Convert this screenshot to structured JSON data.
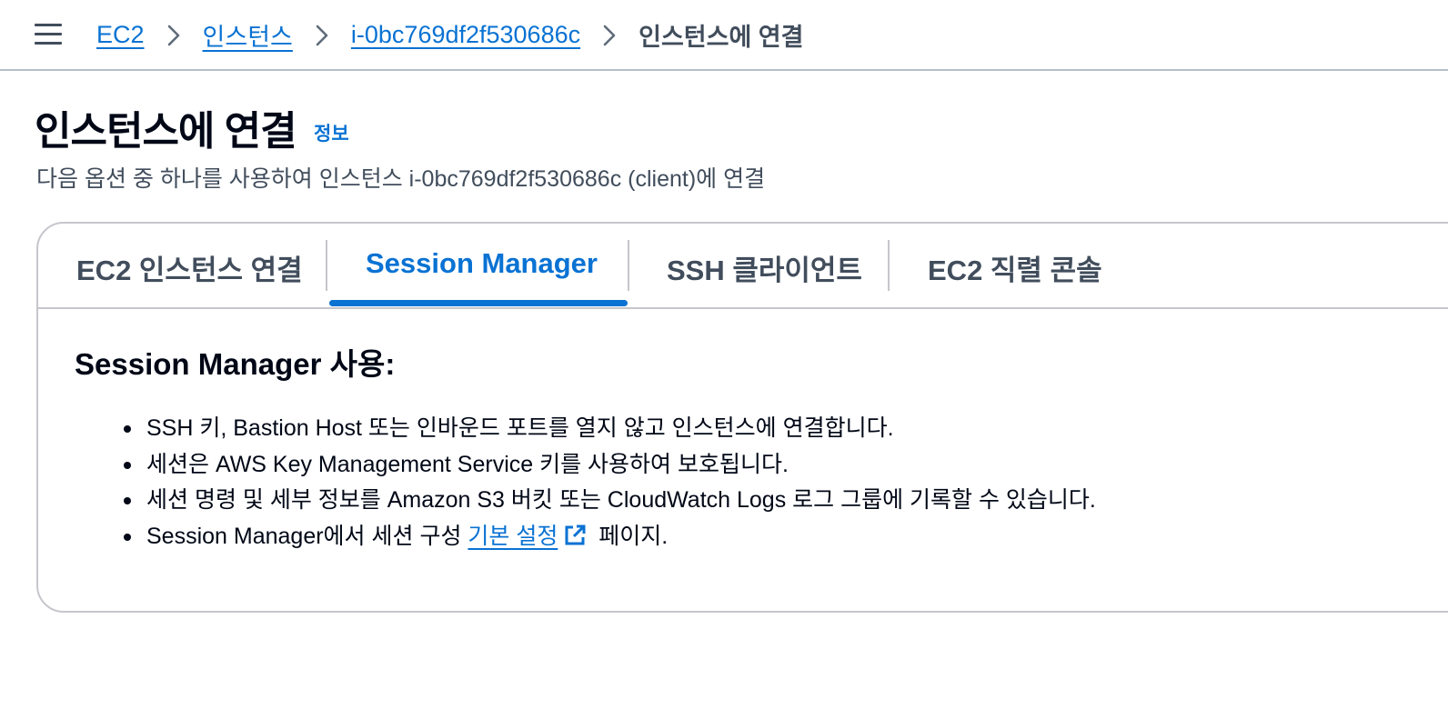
{
  "breadcrumb": {
    "items": [
      {
        "label": "EC2"
      },
      {
        "label": "인스턴스"
      },
      {
        "label": "i-0bc769df2f530686c"
      }
    ],
    "current": "인스턴스에 연결"
  },
  "header": {
    "title": "인스턴스에 연결",
    "info_link": "정보",
    "subtitle": "다음 옵션 중 하나를 사용하여 인스턴스 i-0bc769df2f530686c (client)에 연결"
  },
  "tabs": [
    {
      "label": "EC2 인스턴스 연결",
      "active": false
    },
    {
      "label": "Session Manager",
      "active": true
    },
    {
      "label": "SSH 클라이언트",
      "active": false
    },
    {
      "label": "EC2 직렬 콘솔",
      "active": false
    }
  ],
  "content": {
    "heading": "Session Manager 사용:",
    "bullets": [
      "SSH 키, Bastion Host 또는 인바운드 포트를 열지 않고 인스턴스에 연결합니다.",
      "세션은 AWS Key Management Service 키를 사용하여 보호됩니다.",
      "세션 명령 및 세부 정보를 Amazon S3 버킷 또는 CloudWatch Logs 로그 그룹에 기록할 수 있습니다."
    ],
    "last_bullet": {
      "prefix": "Session Manager에서 세션 구성 ",
      "link": "기본 설정",
      "suffix": " 페이지."
    }
  },
  "icons": {
    "menu": "hamburger-menu-icon",
    "separator": "chevron-right-icon",
    "external": "external-link-icon"
  },
  "colors": {
    "link": "#0972d3",
    "text": "#000716",
    "muted": "#414d5c",
    "border": "#c6c6cd"
  }
}
